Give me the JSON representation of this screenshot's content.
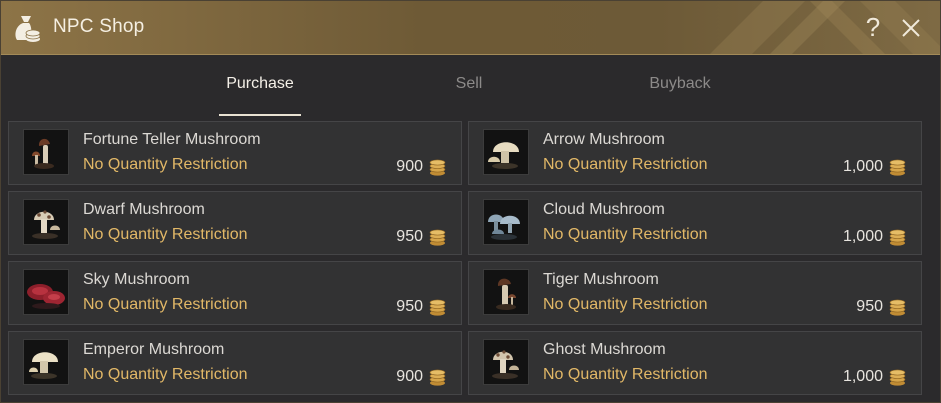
{
  "window": {
    "title": "NPC Shop",
    "help_label": "?",
    "icons": {
      "title": "money-bag-icon",
      "help": "question-icon",
      "close": "close-icon"
    }
  },
  "tabs": [
    {
      "label": "Purchase",
      "active": true
    },
    {
      "label": "Sell",
      "active": false
    },
    {
      "label": "Buyback",
      "active": false
    }
  ],
  "items": [
    {
      "name": "Fortune Teller Mushroom",
      "restriction": "No Quantity Restriction",
      "price": "900",
      "icon": "brown-mushroom-icon"
    },
    {
      "name": "Arrow Mushroom",
      "restriction": "No Quantity Restriction",
      "price": "1,000",
      "icon": "cream-mushroom-icon"
    },
    {
      "name": "Dwarf Mushroom",
      "restriction": "No Quantity Restriction",
      "price": "950",
      "icon": "spotted-mushroom-icon"
    },
    {
      "name": "Cloud Mushroom",
      "restriction": "No Quantity Restriction",
      "price": "1,000",
      "icon": "blue-mushroom-icon"
    },
    {
      "name": "Sky Mushroom",
      "restriction": "No Quantity Restriction",
      "price": "950",
      "icon": "red-mushroom-icon"
    },
    {
      "name": "Tiger Mushroom",
      "restriction": "No Quantity Restriction",
      "price": "950",
      "icon": "brown-mushroom-icon"
    },
    {
      "name": "Emperor Mushroom",
      "restriction": "No Quantity Restriction",
      "price": "900",
      "icon": "cream-mushroom-icon"
    },
    {
      "name": "Ghost Mushroom",
      "restriction": "No Quantity Restriction",
      "price": "1,000",
      "icon": "spotted-mushroom-icon"
    }
  ],
  "colors": {
    "title_bar": "#7b6640",
    "restriction_text": "#e2b867",
    "coin": "#d6a54a",
    "panel": "#2b2a2c"
  }
}
